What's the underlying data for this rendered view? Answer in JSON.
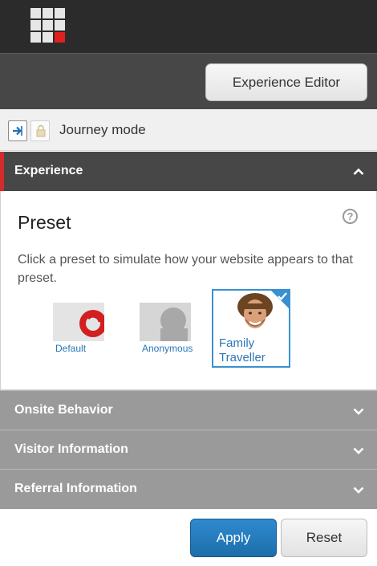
{
  "header": {
    "logo_icon": "sitecore-grid-icon",
    "accent_color": "#e02020"
  },
  "toolbar": {
    "editor_button_label": "Experience Editor"
  },
  "journey": {
    "label": "Journey mode",
    "icons": [
      "enter-journey-icon",
      "locked-document-icon"
    ]
  },
  "experience": {
    "section_label": "Experience",
    "preset_title": "Preset",
    "description": "Click a preset to simulate how your website appears to that preset.",
    "presets": [
      {
        "label": "Default",
        "selected": false
      },
      {
        "label": "Anonymous",
        "selected": false
      },
      {
        "label": "Family Traveller",
        "selected": true
      }
    ]
  },
  "sections": [
    {
      "label": "Onsite Behavior"
    },
    {
      "label": "Visitor Information"
    },
    {
      "label": "Referral Information"
    }
  ],
  "footer": {
    "apply_label": "Apply",
    "reset_label": "Reset"
  },
  "colors": {
    "primary": "#1d6eaa",
    "section_dark": "#474747",
    "section_gray": "#9a9a9a",
    "accent_red": "#d42b2b"
  }
}
